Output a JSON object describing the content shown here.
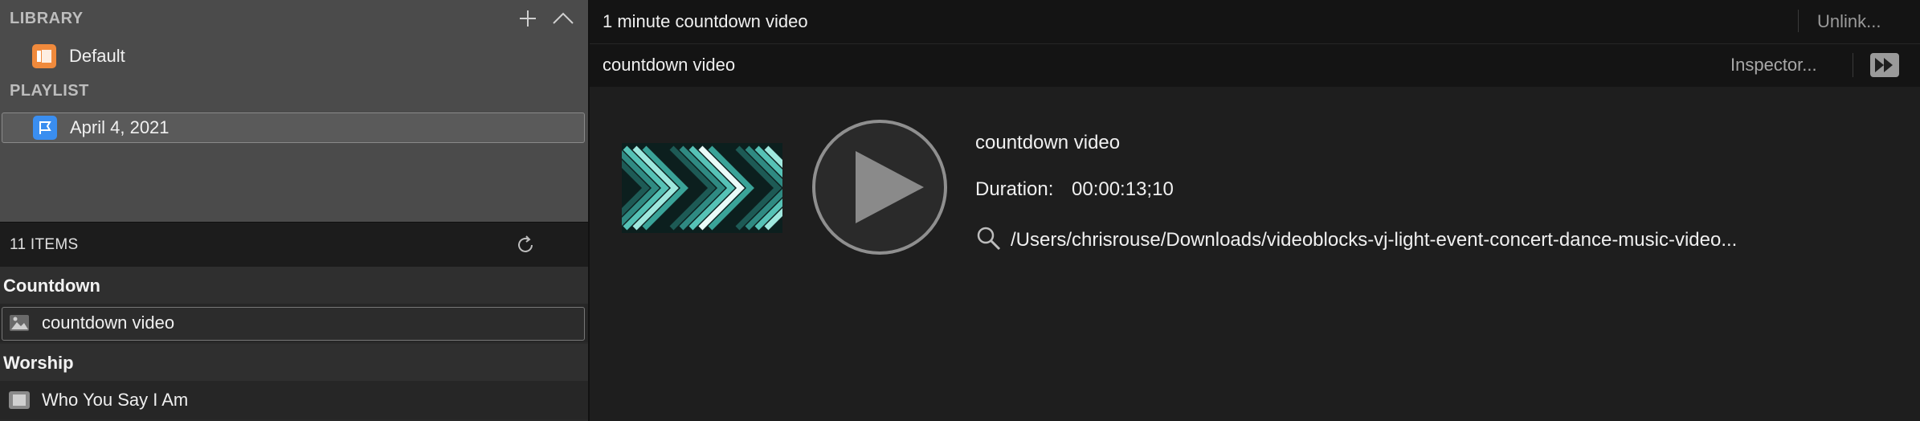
{
  "library": {
    "heading": "LIBRARY",
    "items": [
      {
        "label": "Default",
        "icon": "library-icon",
        "color": "#f08a3c"
      }
    ]
  },
  "playlist": {
    "heading": "PLAYLIST",
    "items": [
      {
        "label": "April 4, 2021",
        "icon": "playlist-flag-icon",
        "color": "#3a8ef0"
      }
    ]
  },
  "items_panel": {
    "count_label": "11 ITEMS",
    "groups": [
      {
        "name": "Countdown",
        "rows": [
          {
            "label": "countdown video",
            "icon": "image-icon"
          }
        ]
      },
      {
        "name": "Worship",
        "rows": [
          {
            "label": "Who You Say I Am",
            "icon": "presentation-icon"
          }
        ]
      }
    ]
  },
  "header": {
    "title": "1 minute countdown video",
    "subtitle": "countdown video",
    "unlink_label": "Unlink...",
    "inspector_label": "Inspector..."
  },
  "media": {
    "title": "countdown video",
    "duration_label": "Duration:",
    "duration_value": "00:00:13;10",
    "path": "/Users/chrisrouse/Downloads/videoblocks-vj-light-event-concert-dance-music-video..."
  },
  "colors": {
    "accent_library": "#f08a3c",
    "accent_playlist": "#3a8ef0",
    "thumb_teal": "#4fd1c5"
  }
}
